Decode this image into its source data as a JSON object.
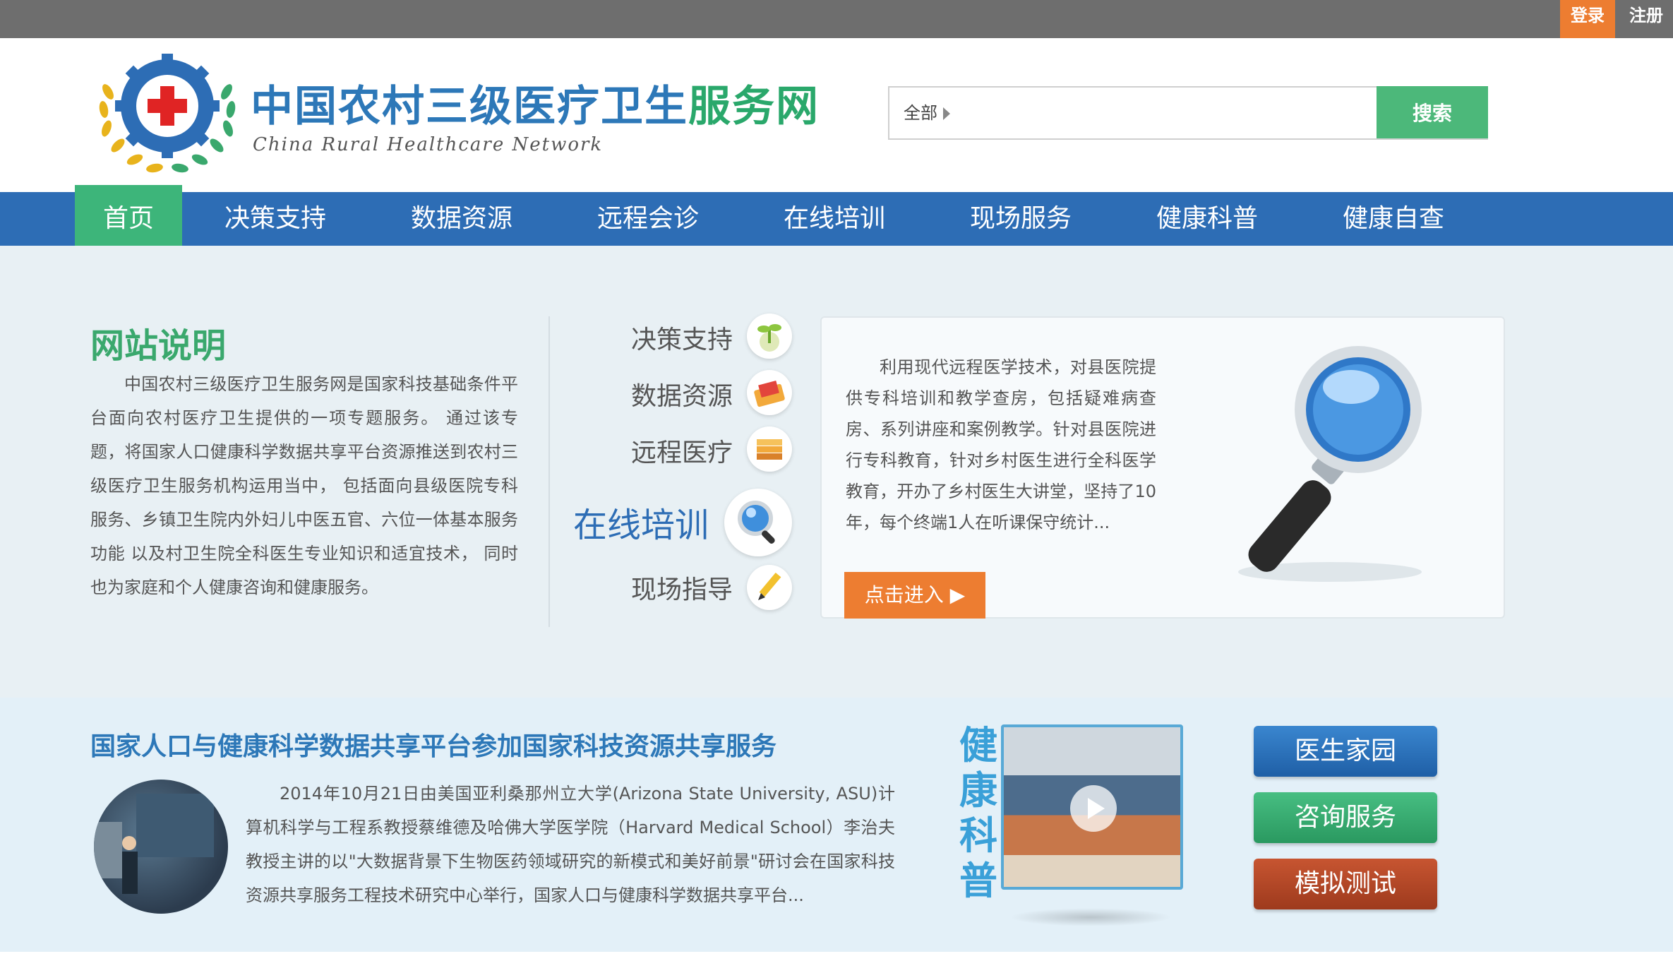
{
  "topbar": {
    "login": "登录",
    "register": "注册"
  },
  "header": {
    "logo_title_part1": "中国农村三级医疗卫生",
    "logo_title_part2": "服务网",
    "logo_subtitle": "China Rural Healthcare Network",
    "search_scope": "全部",
    "search_value": "",
    "search_button": "搜索"
  },
  "nav": {
    "items": [
      {
        "label": "首页"
      },
      {
        "label": "决策支持"
      },
      {
        "label": "数据资源"
      },
      {
        "label": "远程会诊"
      },
      {
        "label": "在线培训"
      },
      {
        "label": "现场服务"
      },
      {
        "label": "健康科普"
      },
      {
        "label": "健康自查"
      }
    ],
    "active": "首页"
  },
  "intro": {
    "title": "网站说明",
    "text": "中国农村三级医疗卫生服务网是国家科技基础条件平台面向农村医疗卫生提供的一项专题服务。 通过该专题，将国家人口健康科学数据共享平台资源推送到农村三级医疗卫生服务机构运用当中， 包括面向县级医院专科服务、乡镇卫生院内外妇儿中医五官、六位一体基本服务功能 以及村卫生院全科医生专业知识和适宜技术， 同时也为家庭和个人健康咨询和健康服务。"
  },
  "services": {
    "items": [
      {
        "label": "决策支持",
        "icon": "sprout-icon"
      },
      {
        "label": "数据资源",
        "icon": "folder-icon"
      },
      {
        "label": "远程医疗",
        "icon": "books-icon"
      },
      {
        "label": "在线培训",
        "icon": "magnifier-icon"
      },
      {
        "label": "现场指导",
        "icon": "pencil-icon"
      }
    ],
    "active": "在线培训"
  },
  "panel": {
    "text": "利用现代远程医学技术，对县医院提供专科培训和教学查房，包括疑难病查房、系列讲座和案例教学。针对县医院进行专科教育，针对乡村医生进行全科医学教育，开办了乡村医生大讲堂，坚持了10年，每个终端1人在听课保守统计...",
    "button": "点击进入"
  },
  "news": {
    "title": "国家人口与健康科学数据共享平台参加国家科技资源共享服务",
    "text": "2014年10月21日由美国亚利桑那州立大学(Arizona State University, ASU)计算机科学与工程系教授蔡维德及哈佛大学医学院（Harvard Medical School）李治夫教授主讲的以\"大数据背景下生物医药领域研究的新模式和美好前景\"研讨会在国家科技资源共享服务工程技术研究中心举行，国家人口与健康科学数据共享平台..."
  },
  "video": {
    "label": "健康科普"
  },
  "side_buttons": [
    {
      "label": "医生家园",
      "color": "#2d6db5"
    },
    {
      "label": "咨询服务",
      "color": "#3aa86d"
    },
    {
      "label": "模拟测试",
      "color": "#b04526"
    }
  ],
  "colors": {
    "accent_orange": "#ed7d31",
    "nav_blue": "#2d6db5",
    "green": "#3db57a"
  }
}
